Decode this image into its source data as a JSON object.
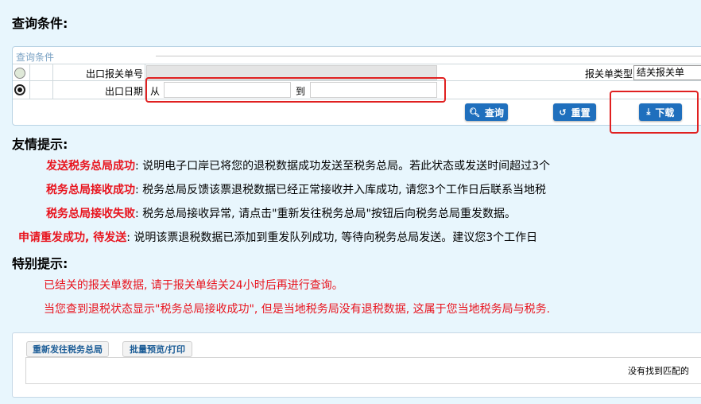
{
  "page_title": "查询条件:",
  "query_panel": {
    "legend": "查询条件",
    "row1_label": "出口报关单号",
    "row2_label": "出口日期",
    "from_label": "从",
    "to_label": "到",
    "from_value": "",
    "to_value": "",
    "type_label": "报关单类型",
    "type_value": "结关报关单",
    "query_button": "查询",
    "reset_button": "重置",
    "download_button": "下载"
  },
  "tips": {
    "heading": "友情提示:",
    "items": [
      {
        "term": "发送税务总局成功",
        "text": ": 说明电子口岸已将您的退税数据成功发送至税务总局。若此状态或发送时间超过3个"
      },
      {
        "term": "税务总局接收成功",
        "text": ": 税务总局反馈该票退税数据已经正常接收并入库成功, 请您3个工作日后联系当地税"
      },
      {
        "term": "税务总局接收失败",
        "text": ": 税务总局接收异常, 请点击\"重新发往税务总局\"按钮后向税务总局重发数据。"
      },
      {
        "term": "申请重发成功, 待发送",
        "text": ": 说明该票退税数据已添加到重发队列成功, 等待向税务总局发送。建议您3个工作日"
      }
    ]
  },
  "special": {
    "heading": "特别提示:",
    "lines": [
      "已结关的报关单数据, 请于报关单结关24小时后再进行查询。",
      "当您查到退税状态显示\"税务总局接收成功\", 但是当地税务局没有退税数据, 这属于您当地税务局与税务."
    ]
  },
  "bottom": {
    "resend_button": "重新发往税务总局",
    "batch_button": "批量预览/打印",
    "empty_text": "没有找到匹配的"
  }
}
